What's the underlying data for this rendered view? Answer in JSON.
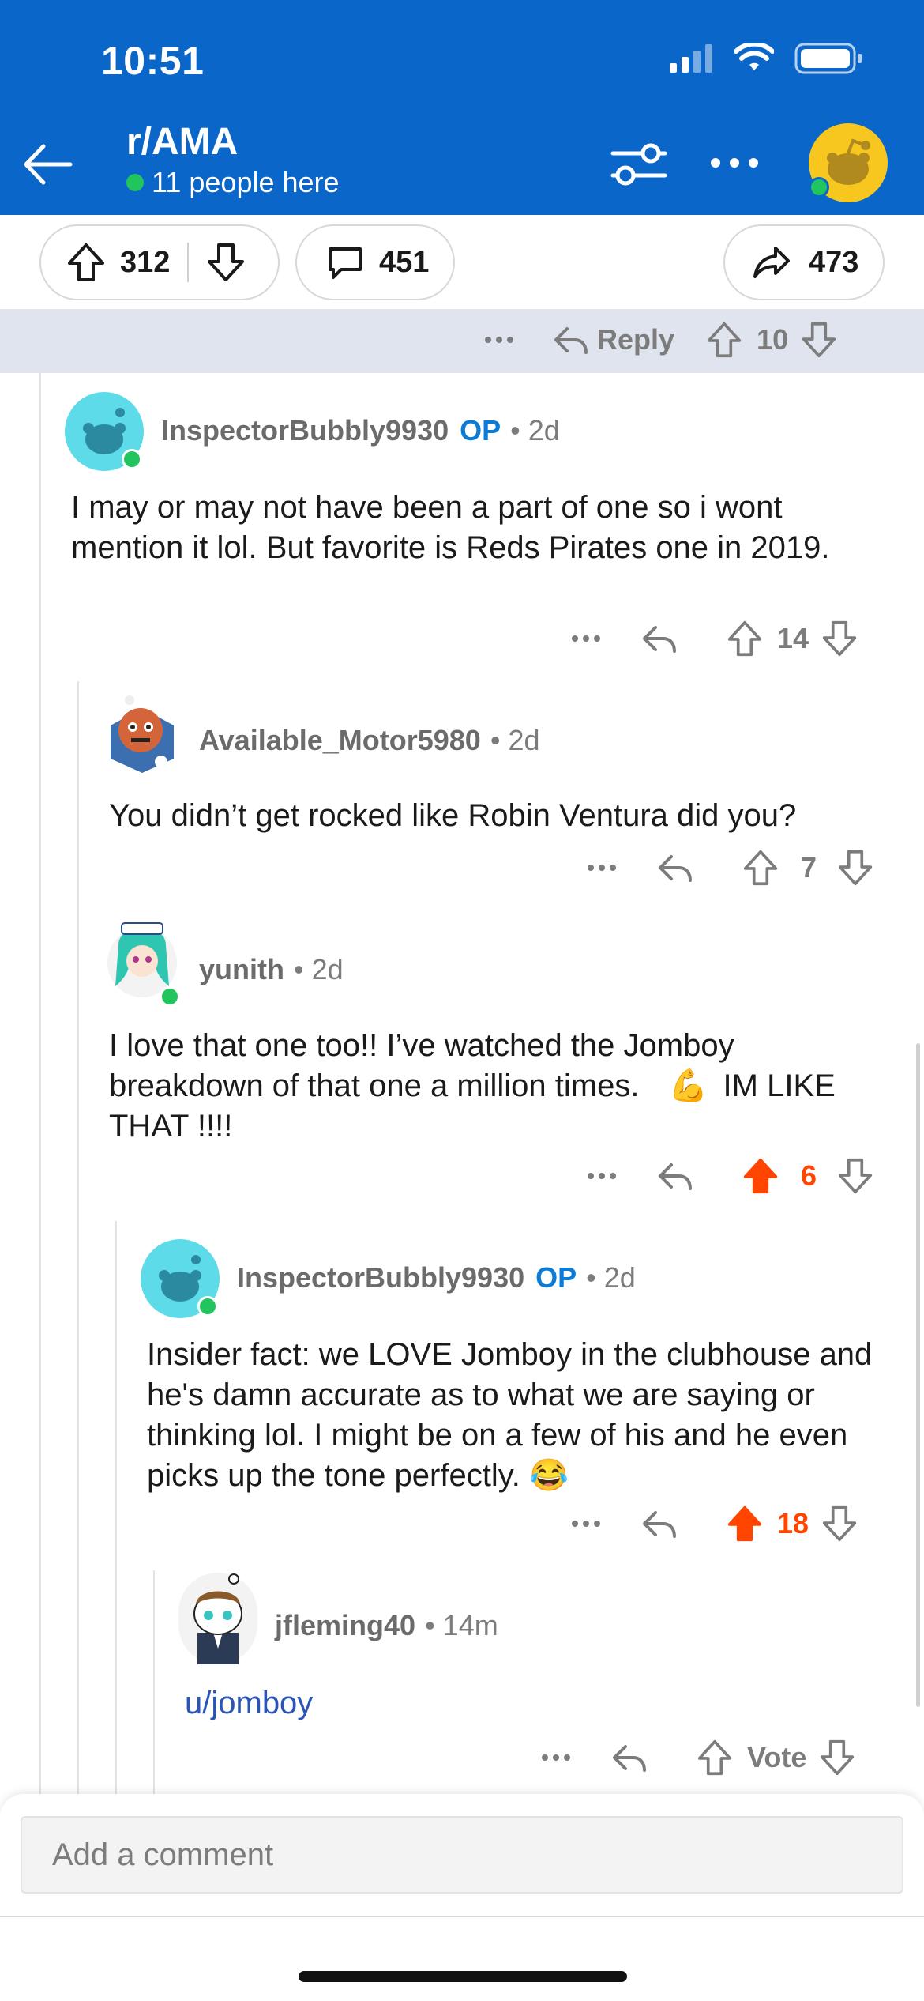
{
  "status_bar": {
    "time": "10:51"
  },
  "header": {
    "subreddit": "r/AMA",
    "online_text": "11 people here"
  },
  "post_actions": {
    "upvotes": "312",
    "comments": "451",
    "shares": "473"
  },
  "parent_row": {
    "reply_label": "Reply",
    "score": "10"
  },
  "comments": [
    {
      "username": "InspectorBubbly9930",
      "op_label": "OP",
      "age": "2d",
      "body": "I may or may not have been a part of one so i wont mention it lol. But favorite is Reds Pirates one in 2019.",
      "score": "14"
    },
    {
      "username": "Available_Motor5980",
      "age": "2d",
      "body": "You didn’t get rocked like Robin Ventura did you?",
      "score": "7"
    },
    {
      "username": "yunith",
      "age": "2d",
      "body_line1": "I love that one too!! I’ve watched the Jomboy",
      "body_line2": "breakdown of that one a million times.",
      "body_emoji": "💪",
      "body_line2_end": "IM LIKE",
      "body_line3": "THAT !!!!",
      "score": "6"
    },
    {
      "username": "InspectorBubbly9930",
      "op_label": "OP",
      "age": "2d",
      "body": "Insider fact: we LOVE Jomboy in the clubhouse and he's damn accurate as to what we are saying or thinking lol. I might be on a few of his and he even picks up the tone perfectly.",
      "body_emoji": "😂",
      "score": "18"
    },
    {
      "username": "jfleming40",
      "age": "14m",
      "body_link": "u/jomboy",
      "score": "Vote"
    }
  ],
  "composer": {
    "placeholder": "Add a comment"
  },
  "colors": {
    "header_bg": "#0a66c9",
    "upvote_active": "#ff4500",
    "op_label": "#0a7bd6",
    "online": "#21c55d"
  }
}
